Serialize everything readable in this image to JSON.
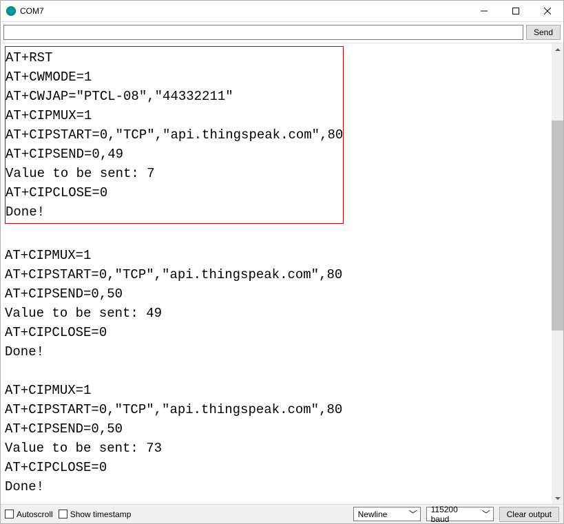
{
  "window": {
    "title": "COM7"
  },
  "send": {
    "value": "",
    "button": "Send"
  },
  "console": {
    "block1": "AT+RST\nAT+CWMODE=1\nAT+CWJAP=\"PTCL-08\",\"44332211\"\nAT+CIPMUX=1\nAT+CIPSTART=0,\"TCP\",\"api.thingspeak.com\",80\nAT+CIPSEND=0,49\nValue to be sent: 7\nAT+CIPCLOSE=0\nDone!",
    "rest": "\nAT+CIPMUX=1\nAT+CIPSTART=0,\"TCP\",\"api.thingspeak.com\",80\nAT+CIPSEND=0,50\nValue to be sent: 49\nAT+CIPCLOSE=0\nDone!\n\nAT+CIPMUX=1\nAT+CIPSTART=0,\"TCP\",\"api.thingspeak.com\",80\nAT+CIPSEND=0,50\nValue to be sent: 73\nAT+CIPCLOSE=0\nDone!"
  },
  "bottom": {
    "autoscroll": "Autoscroll",
    "timestamp": "Show timestamp",
    "line_ending": "Newline",
    "baud": "115200 baud",
    "clear": "Clear output"
  }
}
